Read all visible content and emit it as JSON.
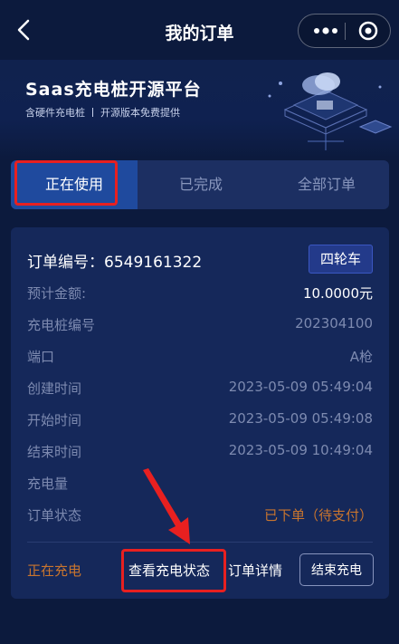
{
  "header": {
    "title": "我的订单",
    "back_icon": "chevron-left-icon",
    "more_icon": "more-dots-icon",
    "close_icon": "target-icon"
  },
  "banner": {
    "title": "Saas充电桩开源平台",
    "subtitle_left": "含硬件充电桩",
    "subtitle_right": "开源版本免费提供"
  },
  "tabs": [
    {
      "label": "正在使用",
      "active": true
    },
    {
      "label": "已完成",
      "active": false
    },
    {
      "label": "全部订单",
      "active": false
    }
  ],
  "order": {
    "number_label": "订单编号：",
    "number_value": "6549161322",
    "vehicle_badge": "四轮车",
    "fields": [
      {
        "label": "预计金额:",
        "value": "10.0000元"
      },
      {
        "label": "充电桩编号",
        "value": "202304100"
      },
      {
        "label": "端口",
        "value": "A枪"
      },
      {
        "label": "创建时间",
        "value": "2023-05-09 05:49:04"
      },
      {
        "label": "开始时间",
        "value": "2023-05-09 05:49:08"
      },
      {
        "label": "结束时间",
        "value": "2023-05-09 10:49:04"
      },
      {
        "label": "充电量",
        "value": ""
      },
      {
        "label": "订单状态",
        "value": "已下单（待支付）"
      }
    ],
    "status": "正在充电",
    "view_status_button": "查看充电状态",
    "detail_button": "订单详情",
    "end_button": "结束充电"
  },
  "colors": {
    "background": "#0c1a3d",
    "card": "#15285a",
    "active_tab": "#1f4a9e",
    "accent_orange": "#c9752e",
    "highlight_red": "#e82020"
  }
}
